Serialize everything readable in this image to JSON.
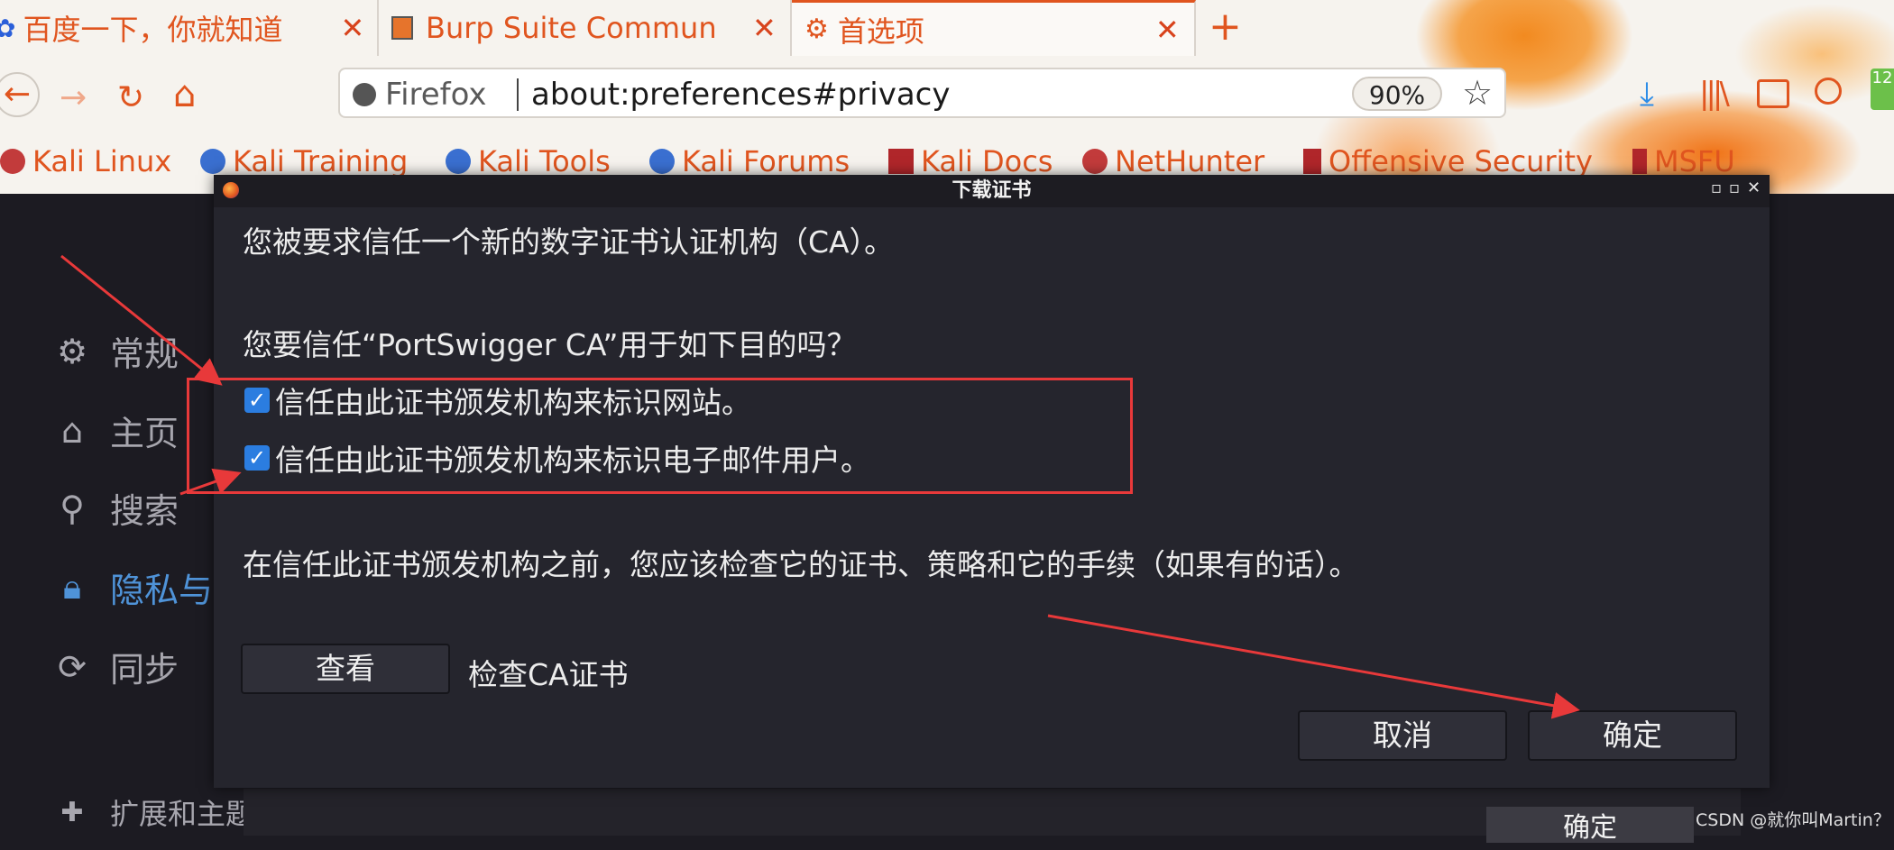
{
  "browser": {
    "tabs": [
      {
        "label": "百度一下，你就知道",
        "icon": "baidu-paw-icon",
        "active": false
      },
      {
        "label": "Burp Suite Commun",
        "icon": "burp-icon",
        "active": false
      },
      {
        "label": "首选项",
        "icon": "gear-icon",
        "active": true
      }
    ],
    "tab_close_glyph": "✕",
    "new_tab_glyph": "+",
    "nav": {
      "back": "←",
      "forward": "→",
      "reload": "↻",
      "home": "⌂"
    },
    "identity_label": "Firefox",
    "url": "about:preferences#privacy",
    "zoom": "90%",
    "badge_count": "12"
  },
  "bookmarks": [
    "Kali Linux",
    "Kali Training",
    "Kali Tools",
    "Kali Forums",
    "Kali Docs",
    "NetHunter",
    "Offensive Security",
    "MSFU"
  ],
  "sidebar": {
    "items": [
      {
        "label": "常规",
        "icon": "gear-icon"
      },
      {
        "label": "主页",
        "icon": "home-icon"
      },
      {
        "label": "搜索",
        "icon": "search-icon"
      },
      {
        "label": "隐私与",
        "icon": "lock-icon",
        "selected": true
      },
      {
        "label": "同步",
        "icon": "sync-icon"
      }
    ],
    "extensions_label": "扩展和主题"
  },
  "dialog": {
    "title": "下载证书",
    "window_controls": {
      "minimize": "▫",
      "maximize": "▫",
      "close": "✕"
    },
    "intro": "您被要求信任一个新的数字证书认证机构（CA）。",
    "question": "您要信任“PortSwigger CA”用于如下目的吗？",
    "options": [
      {
        "label": "信任由此证书颁发机构来标识网站。",
        "checked": true
      },
      {
        "label": "信任由此证书颁发机构来标识电子邮件用户。",
        "checked": true
      }
    ],
    "advice": "在信任此证书颁发机构之前，您应该检查它的证书、策略和它的手续（如果有的话）。",
    "view_button": "查看",
    "view_caption": "检查CA证书",
    "cancel_button": "取消",
    "ok_button": "确定"
  },
  "background_ok": "确定",
  "watermark": "CSDN @就你叫Martin？",
  "colors": {
    "accent": "#e0551f",
    "checkbox": "#2b7de0",
    "annotation": "#e8393a",
    "selected_nav": "#4f93d8"
  }
}
